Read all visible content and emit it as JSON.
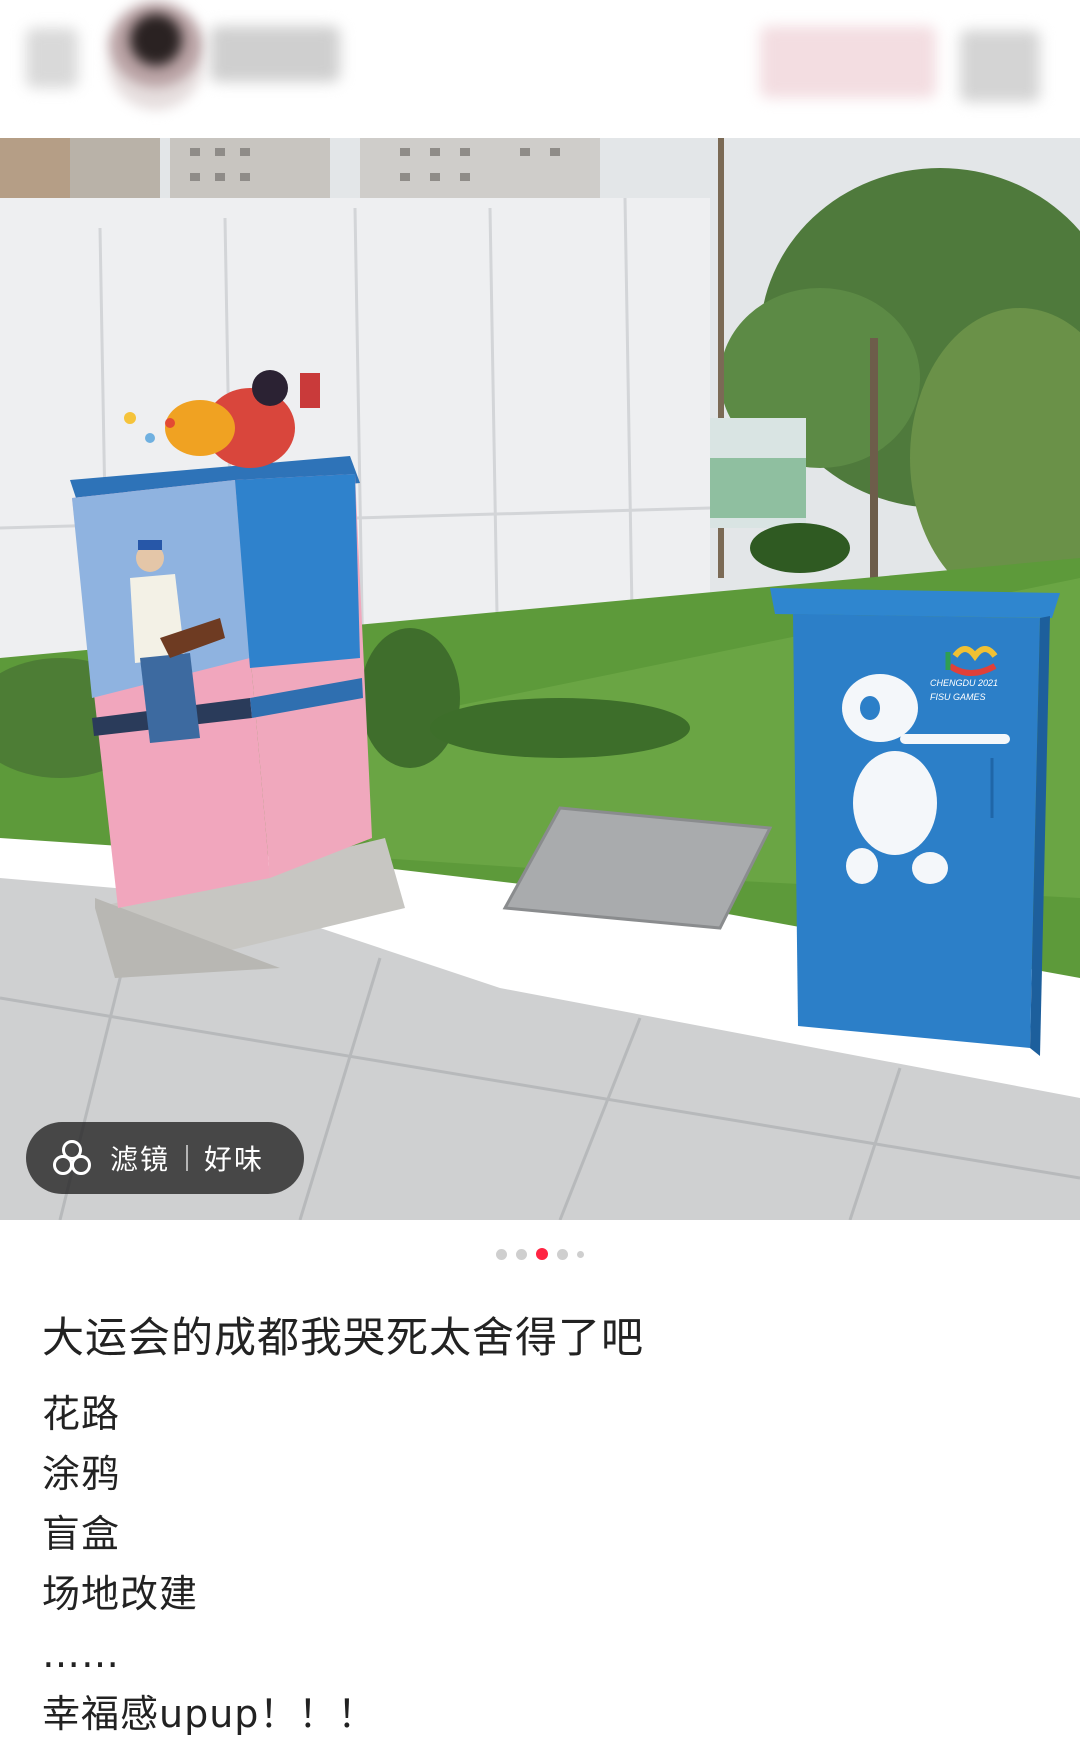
{
  "post": {
    "title": "大运会的成都我哭死太舍得了吧",
    "lines": [
      "花路",
      "涂鸦",
      "盲盒",
      "场地改建",
      "……",
      "幸福感upup！！！"
    ]
  },
  "photo": {
    "filter_label": "滤镜",
    "filter_name": "好味",
    "filter_icon": "filter-icon",
    "box_logo_text": [
      "CHENGDU 2021",
      "FISU GAMES"
    ]
  },
  "carousel": {
    "total": 5,
    "active_index": 2
  },
  "colors": {
    "accent": "#ff2442",
    "cabinet_blue": "#2f86cf",
    "cabinet_pink": "#f2a9c0"
  }
}
